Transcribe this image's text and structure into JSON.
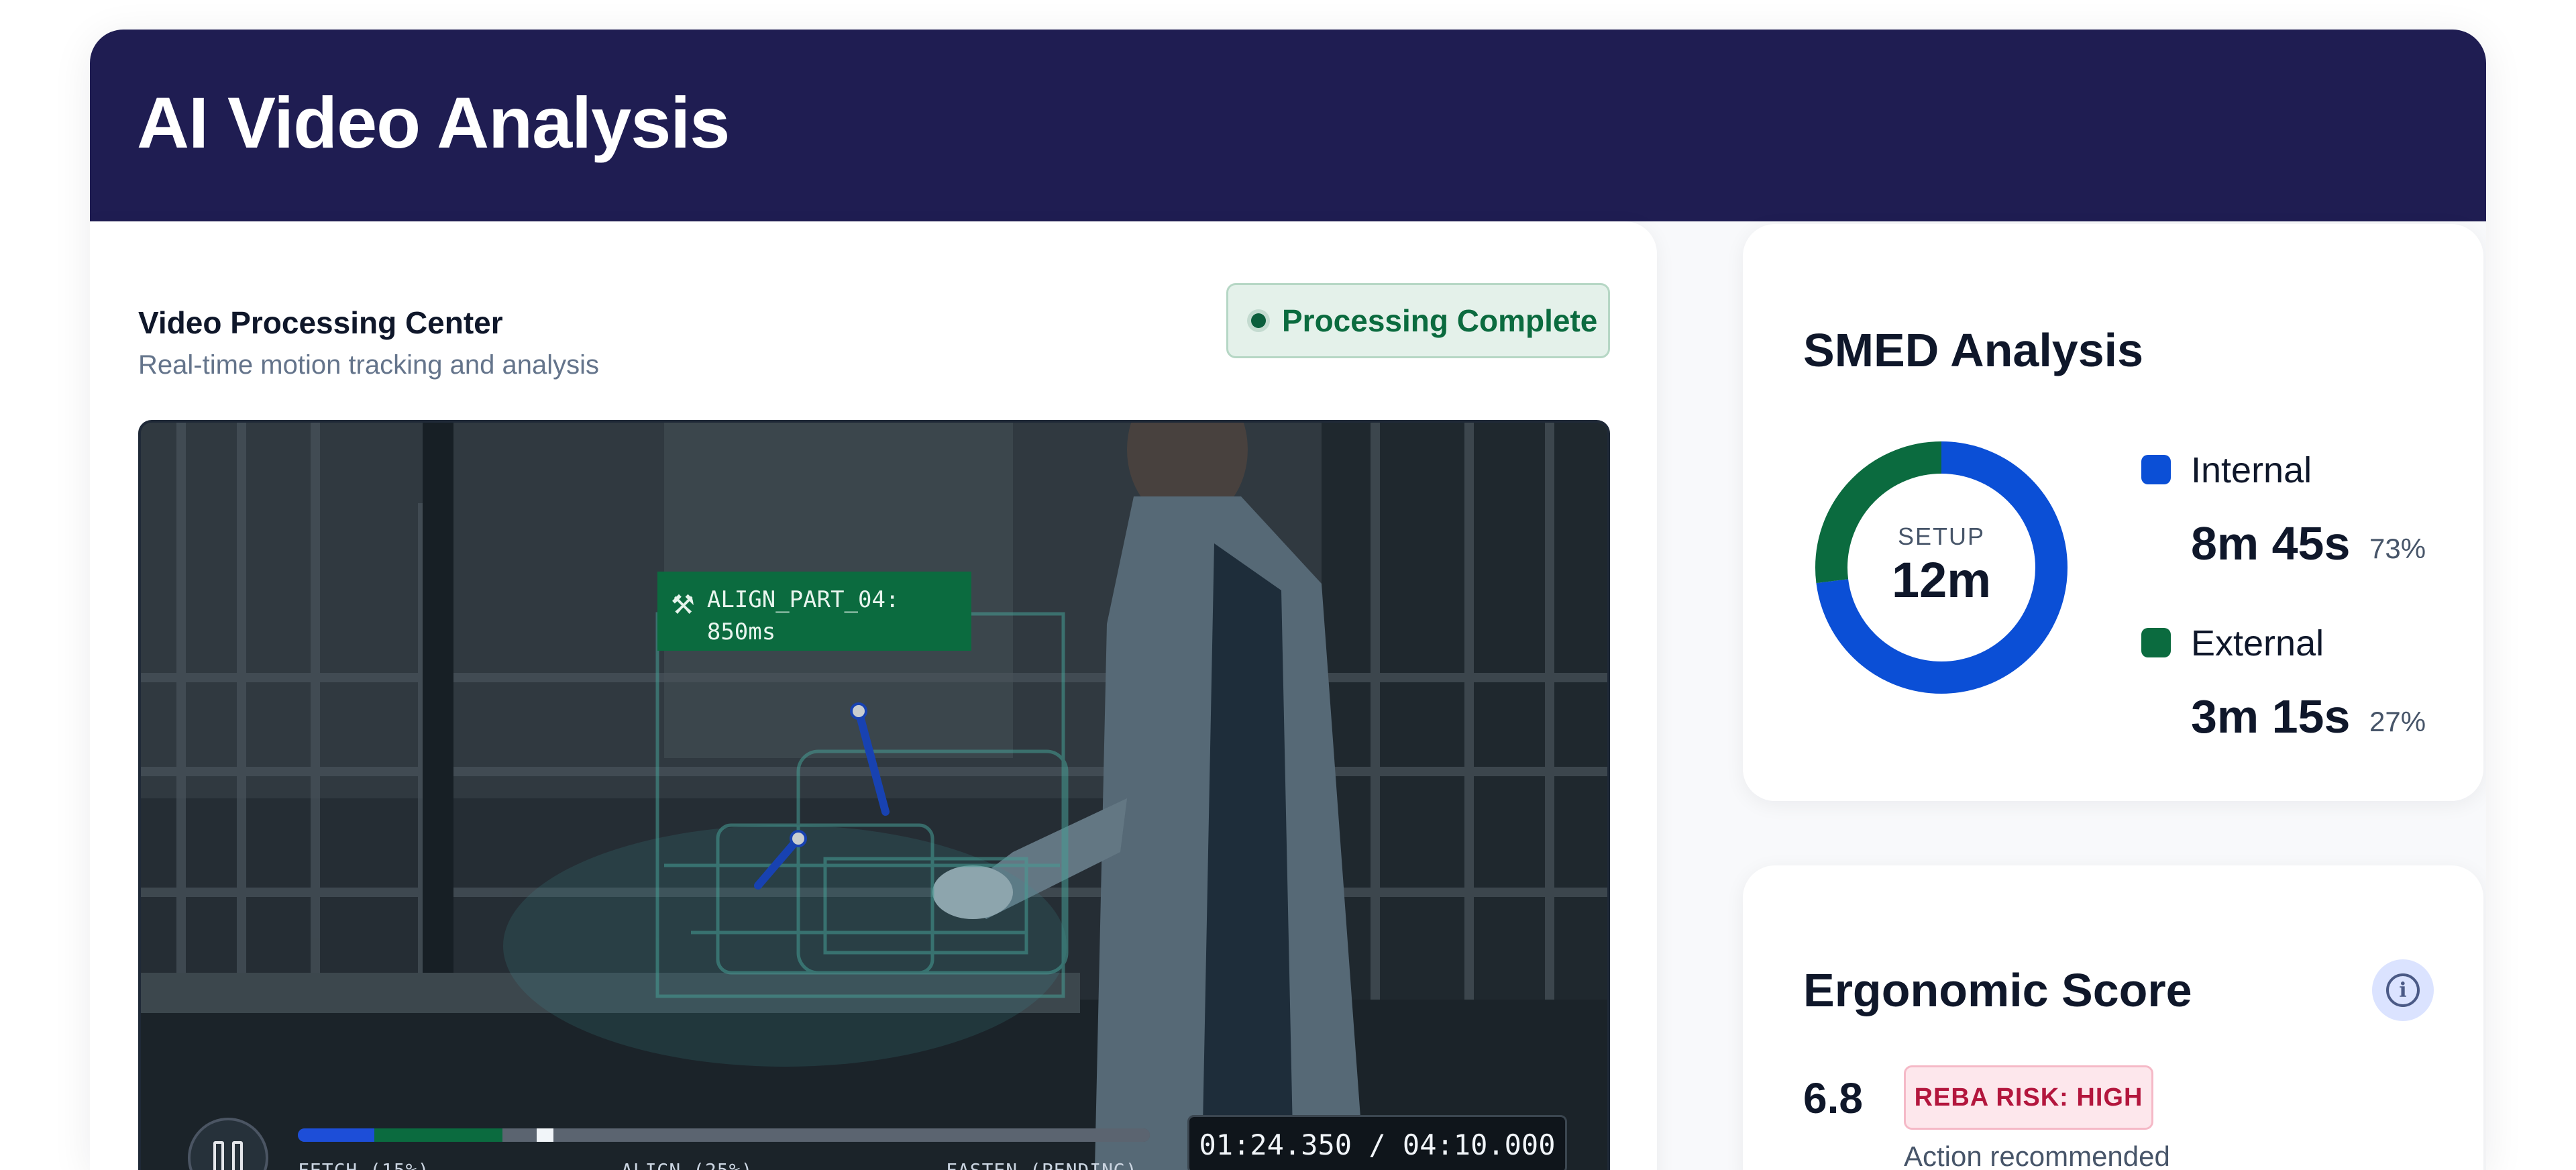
{
  "header": {
    "title": "AI Video Analysis"
  },
  "video_panel": {
    "title": "Video Processing Center",
    "subtitle": "Real-time motion tracking and analysis",
    "status": "Processing Complete",
    "overlay_tag": {
      "icon": "robot-arm-icon",
      "text": "ALIGN_PART_04: 850ms"
    },
    "player": {
      "timecode": "01:24.350 / 04:10.000",
      "segments": [
        {
          "label": "FETCH (15%)",
          "color": "#1d4ed8",
          "fraction": 0.09
        },
        {
          "label": "ALIGN (25%)",
          "color": "#0b6b3f",
          "fraction": 0.15
        },
        {
          "label": "FASTEN (PENDING)",
          "color": "#5b6470",
          "fraction": 0.76
        }
      ],
      "playhead_fraction": 0.28,
      "pause_icon": "pause-icon"
    }
  },
  "smed": {
    "title": "SMED Analysis",
    "center_label": "SETUP",
    "center_value": "12m",
    "items": [
      {
        "label": "Internal",
        "value": "8m 45s",
        "pct": "73%",
        "color": "#0b4fd6",
        "fraction": 0.73
      },
      {
        "label": "External",
        "value": "3m 15s",
        "pct": "27%",
        "color": "#0b6b3f",
        "fraction": 0.27
      }
    ]
  },
  "ergonomic": {
    "title": "Ergonomic Score",
    "score": "6.8",
    "risk": "REBA RISK: HIGH",
    "risk_note": "Action recommended",
    "info_icon": "info-icon"
  }
}
